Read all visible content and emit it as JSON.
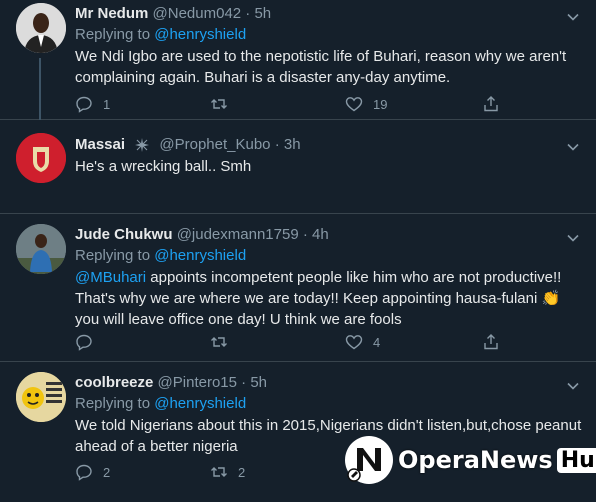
{
  "colors": {
    "background": "#15202b",
    "link": "#1da1f2",
    "muted": "#8899a6",
    "divider": "#38444d"
  },
  "tweets": [
    {
      "name": "Mr Nedum",
      "handle": "@Nedum042",
      "dot": "·",
      "time": "5h",
      "replying_label": "Replying to",
      "replying_handle": "@henryshield",
      "text": "We Ndi Igbo are used to the nepotistic life of Buhari, reason why we aren't complaining again. Buhari is a disaster any-day anytime.",
      "reply_count": "1",
      "retweet_count": "",
      "like_count": "19"
    },
    {
      "name": "Massai",
      "handle": "@Prophet_Kubo",
      "dot": "·",
      "time": "3h",
      "text": "He's a wrecking ball.. Smh",
      "reply_count": "",
      "retweet_count": "",
      "like_count": ""
    },
    {
      "name": "Jude Chukwu",
      "handle": "@judexmann1759",
      "dot": "·",
      "time": "4h",
      "replying_label": "Replying to",
      "replying_handle": "@henryshield",
      "mention": "@MBuhari",
      "text": " appoints incompetent people like him who are not productive!! That's why we are where we are today!! Keep appointing hausa-fulani 👏 you will leave office one day! U think we are fools",
      "reply_count": "",
      "retweet_count": "",
      "like_count": "4"
    },
    {
      "name": "coolbreeze",
      "handle": "@Pintero15",
      "dot": "·",
      "time": "5h",
      "replying_label": "Replying to",
      "replying_handle": "@henryshield",
      "text": "We told Nigerians about this in 2015,Nigerians didn't listen,but,chose peanut ahead of a better nigeria",
      "reply_count": "2",
      "retweet_count": "2",
      "like_count": ""
    }
  ],
  "watermark": {
    "brand": "OperaNews",
    "hub": "Hub"
  }
}
